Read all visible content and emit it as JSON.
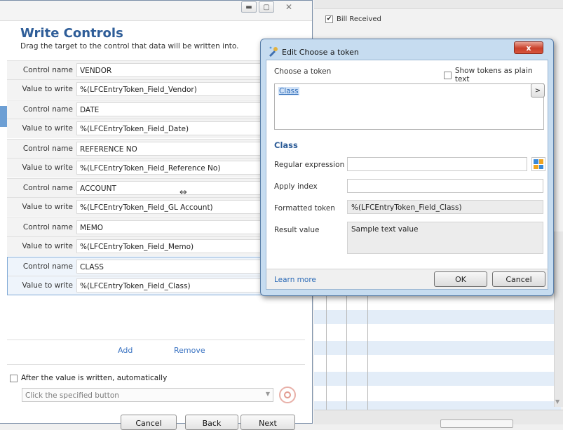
{
  "background_app": {
    "bill_received_label": "Bill Received",
    "bill_received_checked": true
  },
  "wizard": {
    "heading": "Write Controls",
    "subheading": "Drag the target to the control that data will be written into.",
    "control_name_label": "Control name",
    "value_to_write_label": "Value to write",
    "mappings": [
      {
        "control": "VENDOR",
        "value": "%(LFCEntryToken_Field_Vendor)"
      },
      {
        "control": "DATE",
        "value": "%(LFCEntryToken_Field_Date)"
      },
      {
        "control": "REFERENCE NO",
        "value": "%(LFCEntryToken_Field_Reference No)"
      },
      {
        "control": "ACCOUNT",
        "value": "%(LFCEntryToken_Field_GL Account)"
      },
      {
        "control": "MEMO",
        "value": "%(LFCEntryToken_Field_Memo)"
      },
      {
        "control": "CLASS",
        "value": "%(LFCEntryToken_Field_Class)"
      }
    ],
    "add_label": "Add",
    "remove_label": "Remove",
    "after_written_label": "After the value is written, automatically",
    "after_written_checked": false,
    "action_placeholder": "Click the specified button",
    "cancel_label": "Cancel",
    "back_label": "Back",
    "next_label": "Next"
  },
  "dialog": {
    "title": "Edit Choose a token",
    "choose_token_label": "Choose a token",
    "plain_text_label": "Show tokens as plain text",
    "plain_text_checked": false,
    "token_text": "Class",
    "arrow_label": ">",
    "section_title": "Class",
    "regex_label": "Regular expression",
    "regex_value": "",
    "apply_index_label": "Apply index",
    "apply_index_value": "",
    "formatted_token_label": "Formatted token",
    "formatted_token_value": "%(LFCEntryToken_Field_Class)",
    "result_value_label": "Result value",
    "result_value": "Sample text value",
    "learn_more_label": "Learn more",
    "ok_label": "OK",
    "cancel_label": "Cancel",
    "close_glyph": "x"
  }
}
